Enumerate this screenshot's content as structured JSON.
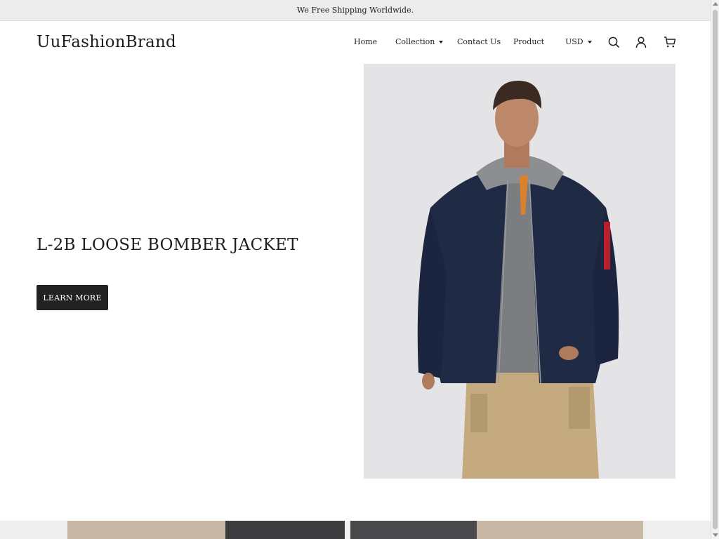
{
  "announcement": {
    "text": "We Free Shipping Worldwide."
  },
  "header": {
    "logo": "UuFashionBrand",
    "nav": [
      {
        "label": "Home",
        "has_dropdown": false
      },
      {
        "label": "Collection",
        "has_dropdown": true
      },
      {
        "label": "Contact Us",
        "has_dropdown": false
      },
      {
        "label": "Product",
        "has_dropdown": false
      }
    ],
    "currency": "USD",
    "icons": [
      "search-icon",
      "account-icon",
      "cart-icon"
    ]
  },
  "hero": {
    "title": "L-2B LOOSE BOMBER JACKET",
    "button_label": "LEARN MORE",
    "image": {
      "subject": "model-in-navy-bomber-jacket",
      "background": "#e4e4e6",
      "jacket_color": "#1f2a44",
      "hoodie_color": "#7c7d80",
      "pants_color": "#c4aa7e",
      "sleeve_patch_color": "#b8202b"
    }
  },
  "colors": {
    "accent": "#222222",
    "announcement_bg": "#ececec"
  }
}
